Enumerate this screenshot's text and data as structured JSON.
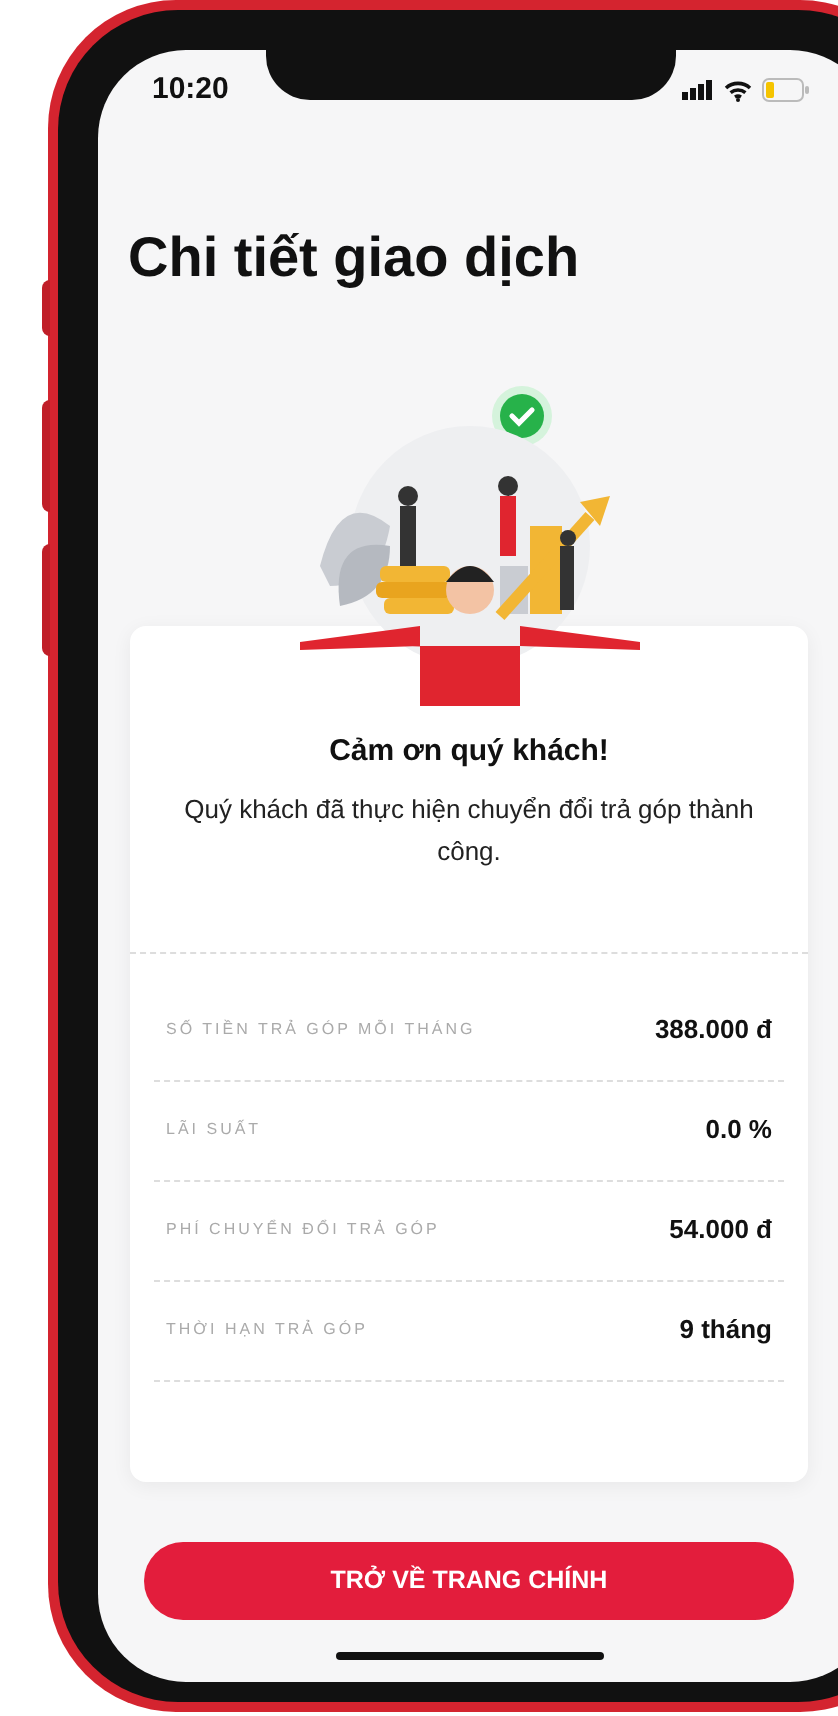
{
  "status_bar": {
    "time": "10:20"
  },
  "title": "Chi tiết giao dịch",
  "message": {
    "heading": "Cảm ơn quý khách!",
    "body": "Quý khách đã thực hiện chuyển đổi trả góp thành công."
  },
  "details": [
    {
      "label": "SỐ TIỀN TRẢ GÓP MỖI THÁNG",
      "value": "388.000 đ"
    },
    {
      "label": "LÃI SUẤT",
      "value": "0.0 %"
    },
    {
      "label": "PHÍ CHUYỂN ĐỔI TRẢ GÓP",
      "value": "54.000 đ"
    },
    {
      "label": "THỜI HẠN TRẢ GÓP",
      "value": "9 tháng"
    }
  ],
  "button": "TRỞ VỀ TRANG CHÍNH"
}
